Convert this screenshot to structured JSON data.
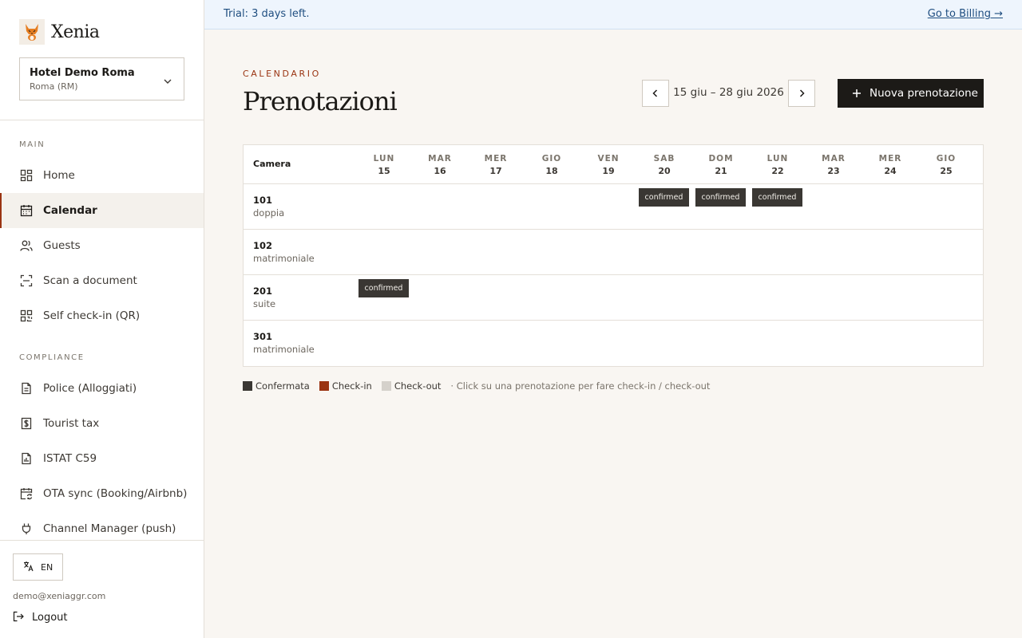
{
  "colors": {
    "accent": "#9a3412",
    "confirmed": "#3a3733",
    "checkin": "#9a3412",
    "checkout": "#d5d1cb",
    "banner_bg": "#eef5fd",
    "banner_text": "#1f4e80"
  },
  "brand": {
    "name": "Xenia",
    "logo_icon": "fox-icon"
  },
  "hotel_selector": {
    "name": "Hotel Demo Roma",
    "location": "Roma (RM)"
  },
  "sidebar": {
    "main_title": "MAIN",
    "main_items": [
      {
        "label": "Home",
        "icon": "home-grid-icon"
      },
      {
        "label": "Calendar",
        "icon": "calendar-icon",
        "active": true
      },
      {
        "label": "Guests",
        "icon": "users-icon"
      },
      {
        "label": "Scan a document",
        "icon": "scan-icon"
      },
      {
        "label": "Self check-in (QR)",
        "icon": "qr-icon"
      }
    ],
    "compliance_title": "COMPLIANCE",
    "compliance_items": [
      {
        "label": "Police (Alloggiati)",
        "icon": "document-icon"
      },
      {
        "label": "Tourist tax",
        "icon": "receipt-dollar-icon"
      },
      {
        "label": "ISTAT C59",
        "icon": "chart-file-icon"
      },
      {
        "label": "OTA sync (Booking/Airbnb)",
        "icon": "calendar-sync-icon"
      },
      {
        "label": "Channel Manager (push)",
        "icon": "plug-icon"
      }
    ],
    "language_label": "EN",
    "user_email": "demo@xeniaggr.com",
    "logout_label": "Logout"
  },
  "banner": {
    "text": "Trial: 3 days left.",
    "link": "Go to Billing →"
  },
  "header": {
    "eyebrow": "CALENDARIO",
    "title": "Prenotazioni",
    "range": "15 giu – 28 giu 2026",
    "new_booking": "Nuova prenotazione"
  },
  "calendar": {
    "room_header": "Camera",
    "days": [
      {
        "wd": "LUN",
        "num": "15"
      },
      {
        "wd": "MAR",
        "num": "16"
      },
      {
        "wd": "MER",
        "num": "17"
      },
      {
        "wd": "GIO",
        "num": "18"
      },
      {
        "wd": "VEN",
        "num": "19"
      },
      {
        "wd": "SAB",
        "num": "20"
      },
      {
        "wd": "DOM",
        "num": "21"
      },
      {
        "wd": "LUN",
        "num": "22"
      },
      {
        "wd": "MAR",
        "num": "23"
      },
      {
        "wd": "MER",
        "num": "24"
      },
      {
        "wd": "GIO",
        "num": "25"
      }
    ],
    "rooms": [
      {
        "number": "101",
        "type": "doppia",
        "bookings": [
          {
            "day": 5,
            "status": "confirmed"
          },
          {
            "day": 6,
            "status": "confirmed"
          },
          {
            "day": 7,
            "status": "confirmed"
          }
        ]
      },
      {
        "number": "102",
        "type": "matrimoniale",
        "bookings": []
      },
      {
        "number": "201",
        "type": "suite",
        "bookings": [
          {
            "day": 0,
            "status": "confirmed"
          }
        ]
      },
      {
        "number": "301",
        "type": "matrimoniale",
        "bookings": []
      }
    ]
  },
  "legend": {
    "confirmed": "Confermata",
    "checkin": "Check-in",
    "checkout": "Check-out",
    "hint": "· Click su una prenotazione per fare check-in / check-out"
  }
}
